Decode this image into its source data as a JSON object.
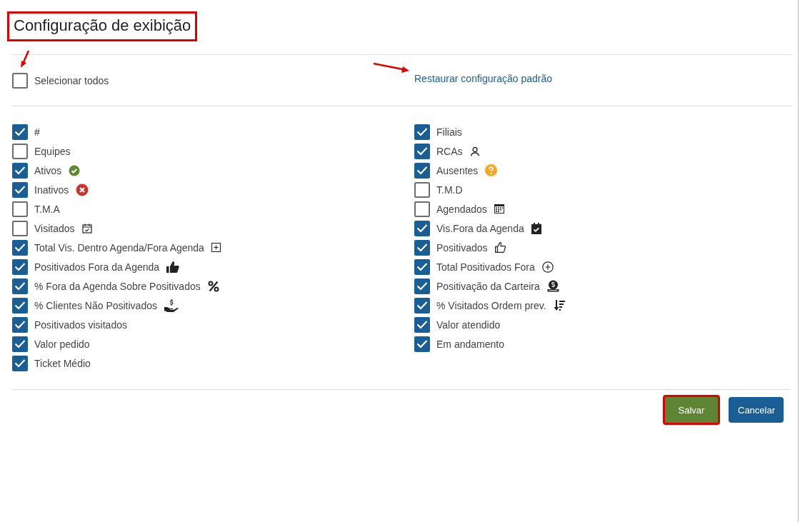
{
  "dialog": {
    "title": "Configuração de exibição",
    "title_highlighted": true
  },
  "select_all": {
    "label": "Selecionar todos",
    "checked": false,
    "arrow_marked": true
  },
  "restore_link": {
    "label": "Restaurar configuração padrão",
    "arrow_marked": true
  },
  "columns": [
    [
      {
        "label": "#",
        "checked": true
      },
      {
        "label": "Equipes",
        "checked": false
      },
      {
        "label": "Ativos",
        "checked": true
      },
      {
        "label": "Inativos",
        "checked": true
      },
      {
        "label": "T.M.A",
        "checked": false
      },
      {
        "label": "Visitados",
        "checked": false
      },
      {
        "label": "Total Vis. Dentro Agenda/Fora Agenda",
        "checked": true
      },
      {
        "label": "Positivados Fora da Agenda",
        "checked": true
      },
      {
        "label": "% Fora da Agenda Sobre Positivados",
        "checked": true
      },
      {
        "label": "% Clientes Não Positivados",
        "checked": true
      },
      {
        "label": "Positivados visitados",
        "checked": true
      },
      {
        "label": "Valor pedido",
        "checked": true
      },
      {
        "label": "Ticket Médio",
        "checked": true
      }
    ],
    [
      {
        "label": "Filiais",
        "checked": true
      },
      {
        "label": "RCAs",
        "checked": true
      },
      {
        "label": "Ausentes",
        "checked": true
      },
      {
        "label": "T.M.D",
        "checked": false
      },
      {
        "label": "Agendados",
        "checked": false
      },
      {
        "label": "Vis.Fora da Agenda",
        "checked": true
      },
      {
        "label": "Positivados",
        "checked": true
      },
      {
        "label": "Total Positivados Fora",
        "checked": true
      },
      {
        "label": "Positivação da Carteira",
        "checked": true
      },
      {
        "label": "% Visitados Ordem prev.",
        "checked": true
      },
      {
        "label": "Valor atendido",
        "checked": true
      },
      {
        "label": "Em andamento",
        "checked": true
      }
    ]
  ],
  "buttons": [
    {
      "label": "Salvar",
      "kind": "primary",
      "highlighted": true
    },
    {
      "label": "Cancelar",
      "kind": "secondary",
      "highlighted": false
    }
  ]
}
